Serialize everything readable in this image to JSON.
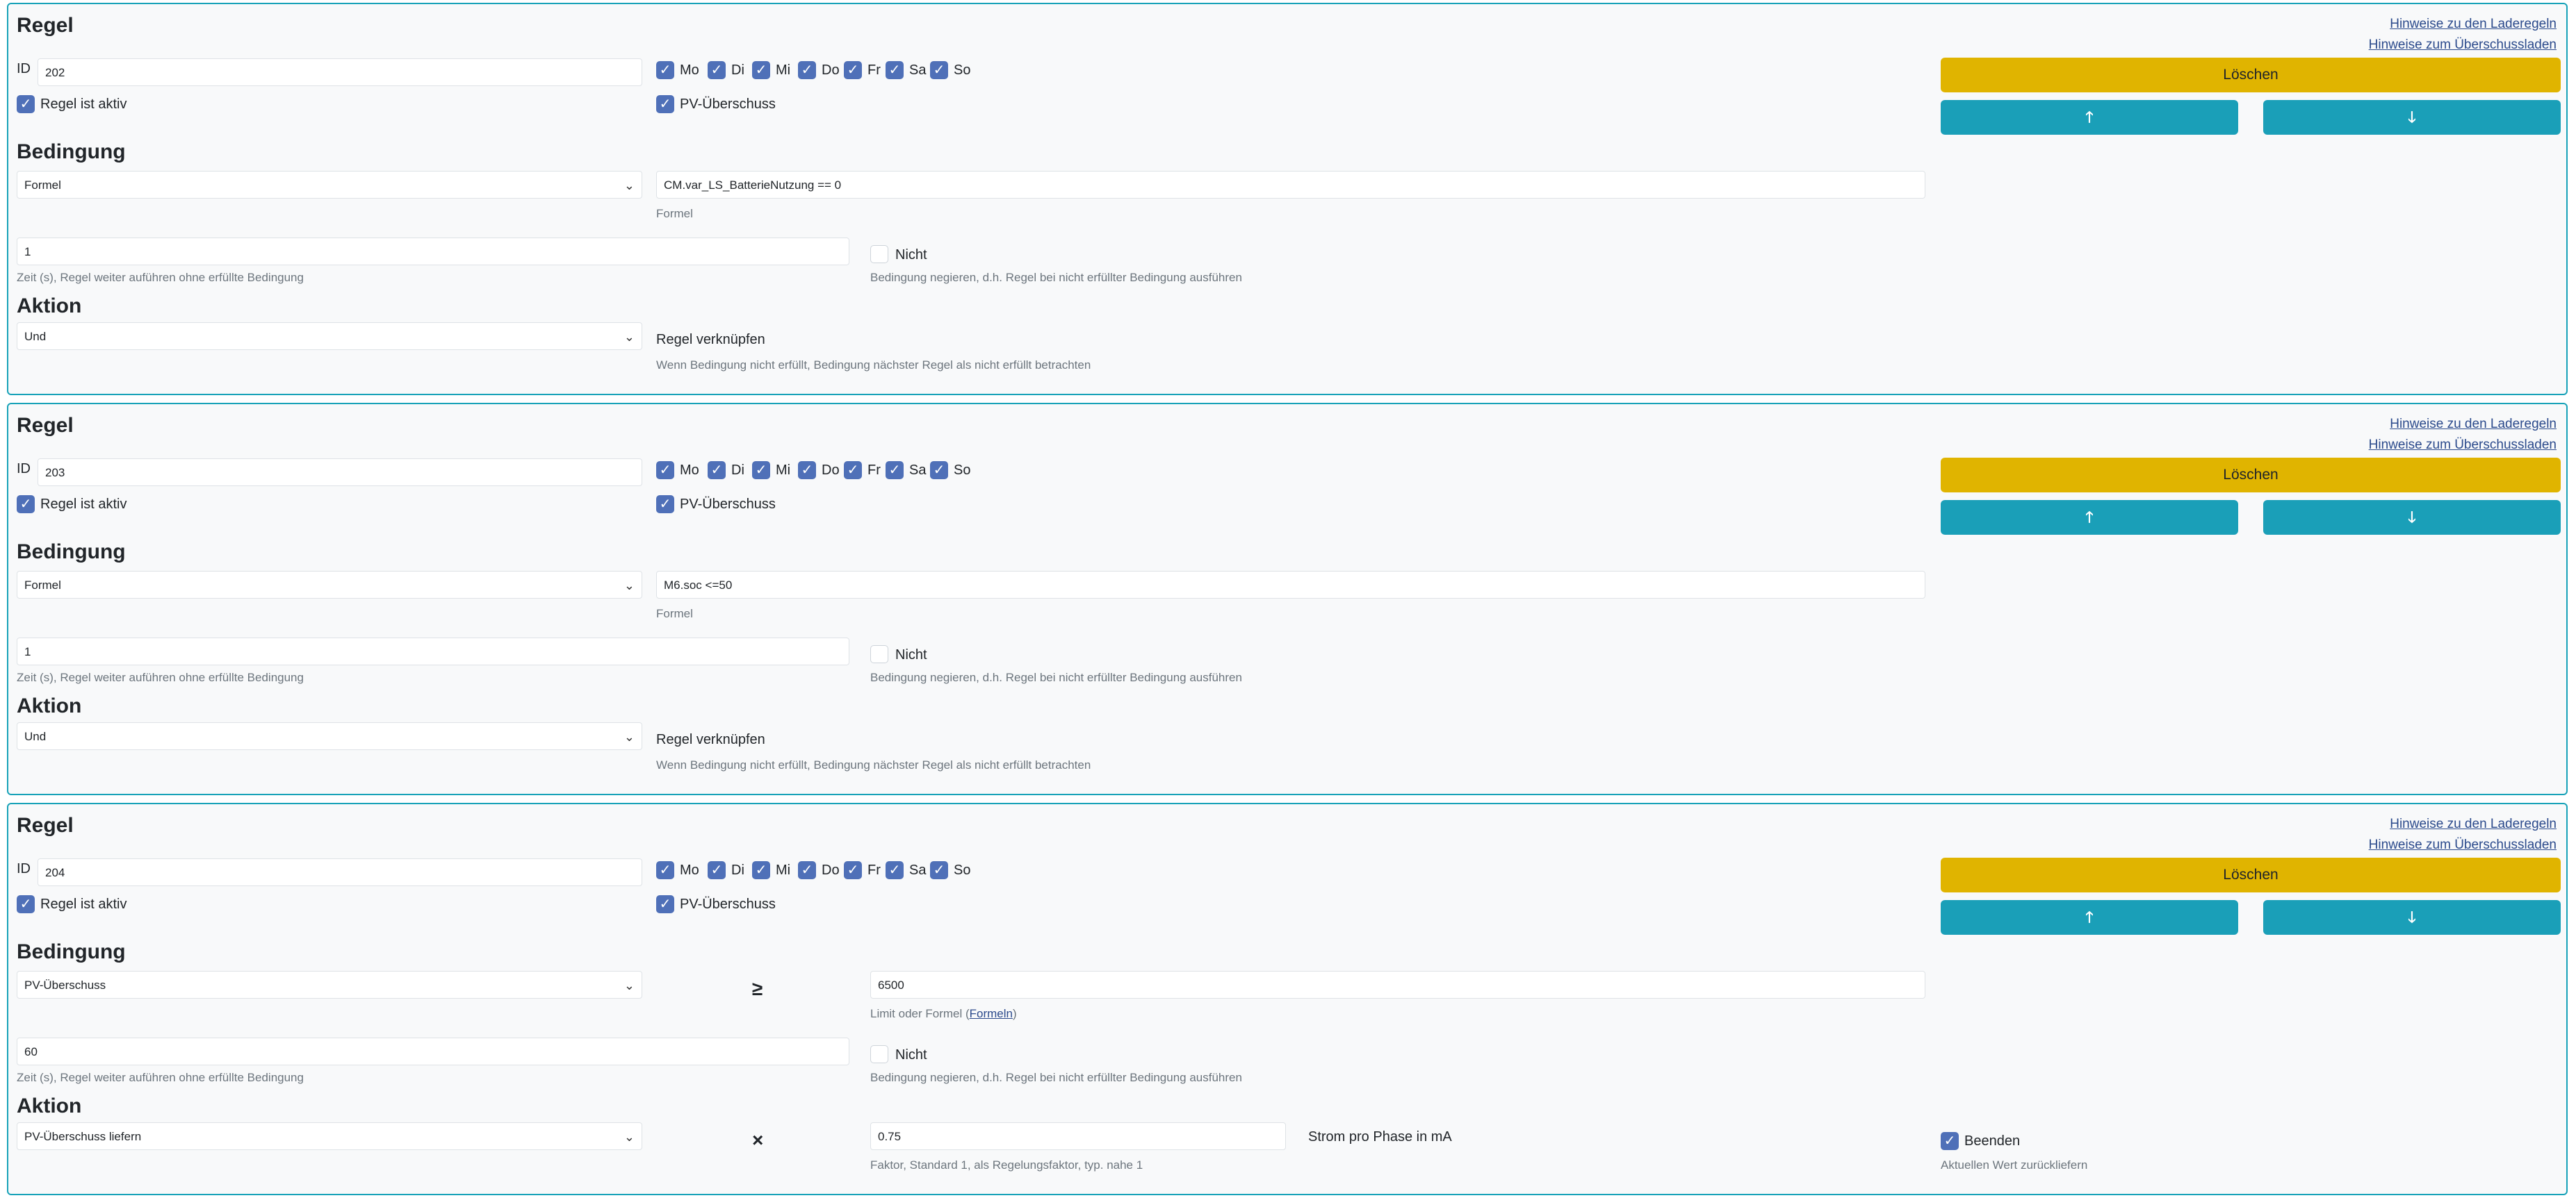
{
  "common": {
    "card_title": "Regel",
    "link_laderegeln": "Hinweise zu den Laderegeln",
    "link_ueberschuss": "Hinweise zum Überschussladen",
    "id_label": "ID",
    "days": [
      "Mo",
      "Di",
      "Mi",
      "Do",
      "Fr",
      "Sa",
      "So"
    ],
    "active_label": "Regel ist aktiv",
    "pv_label": "PV-Überschuss",
    "delete_label": "Löschen",
    "up_icon": "arrow-up-icon",
    "down_icon": "arrow-down-icon",
    "bedingung_title": "Bedingung",
    "aktion_title": "Aktion",
    "time_help": "Zeit (s), Regel weiter auführen ohne erfüllte Bedingung",
    "not_label": "Nicht",
    "not_help": "Bedingung negieren, d.h. Regel bei nicht erfüllter Bedingung ausführen",
    "formel_help": "Formel",
    "link_rule_label": "Regel verknüpfen",
    "link_rule_help": "Wenn Bedingung nicht erfüllt, Bedingung nächster Regel als nicht erfüllt betrachten",
    "up_glyph": "🡑",
    "down_glyph": "🡓"
  },
  "rules": [
    {
      "id": "202",
      "condition_type": "Formel",
      "formula": "CM.var_LS_BatterieNutzung == 0",
      "time": "1",
      "action": "Und"
    },
    {
      "id": "203",
      "condition_type": "Formel",
      "formula": "M6.soc <=50",
      "time": "1",
      "action": "Und"
    },
    {
      "id": "204",
      "condition_type": "PV-Überschuss",
      "operator": "≥",
      "limit": "6500",
      "limit_help_prefix": "Limit oder Formel (",
      "limit_help_link": "Formeln",
      "limit_help_suffix": ")",
      "time": "60",
      "action": "PV-Überschuss liefern",
      "multiply": "×",
      "factor": "0.75",
      "factor_help": "Faktor, Standard 1, als Regelungsfaktor, typ. nahe 1",
      "unit_label": "Strom pro Phase in mA",
      "beenden_label": "Beenden",
      "beenden_help": "Aktuellen Wert zurückliefern"
    }
  ],
  "colors": {
    "border": "#17a2b8",
    "delete": "#e0b400",
    "move": "#1a9fb8",
    "checkbox": "#4f70b8",
    "link": "#2b4a8c"
  }
}
